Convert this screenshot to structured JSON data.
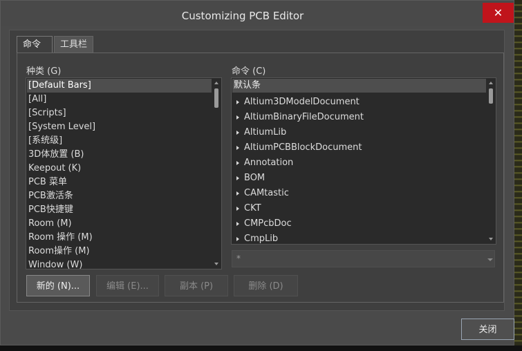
{
  "window": {
    "title": "Customizing PCB Editor",
    "close_glyph": "✕"
  },
  "tabs": [
    {
      "label": "命令"
    },
    {
      "label": "工具栏"
    }
  ],
  "categories": {
    "label": "种类 (G)",
    "items": [
      "[Default Bars]",
      "[All]",
      "[Scripts]",
      "[System Level]",
      "[系统级]",
      "3D体放置 (B)",
      "Keepout (K)",
      "PCB 菜单",
      "PCB激活条",
      "PCB快捷键",
      "Room (M)",
      "Room 操作 (M)",
      "Room操作 (M)",
      "Window (W)"
    ],
    "selected_index": 0
  },
  "commands": {
    "label": "命令 (C)",
    "header": "默认条",
    "items": [
      "Altium3DModelDocument",
      "AltiumBinaryFileDocument",
      "AltiumLib",
      "AltiumPCBBlockDocument",
      "Annotation",
      "BOM",
      "CAMtastic",
      "CKT",
      "CMPcbDoc",
      "CmpLib"
    ],
    "filter_value": "*"
  },
  "buttons": {
    "new": "新的 (N)...",
    "edit": "编辑 (E)...",
    "copy": "副本 (P)",
    "delete": "删除 (D)",
    "close": "关闭"
  },
  "colors": {
    "close_button": "#c0141b",
    "selection": "#4e4e4e"
  }
}
